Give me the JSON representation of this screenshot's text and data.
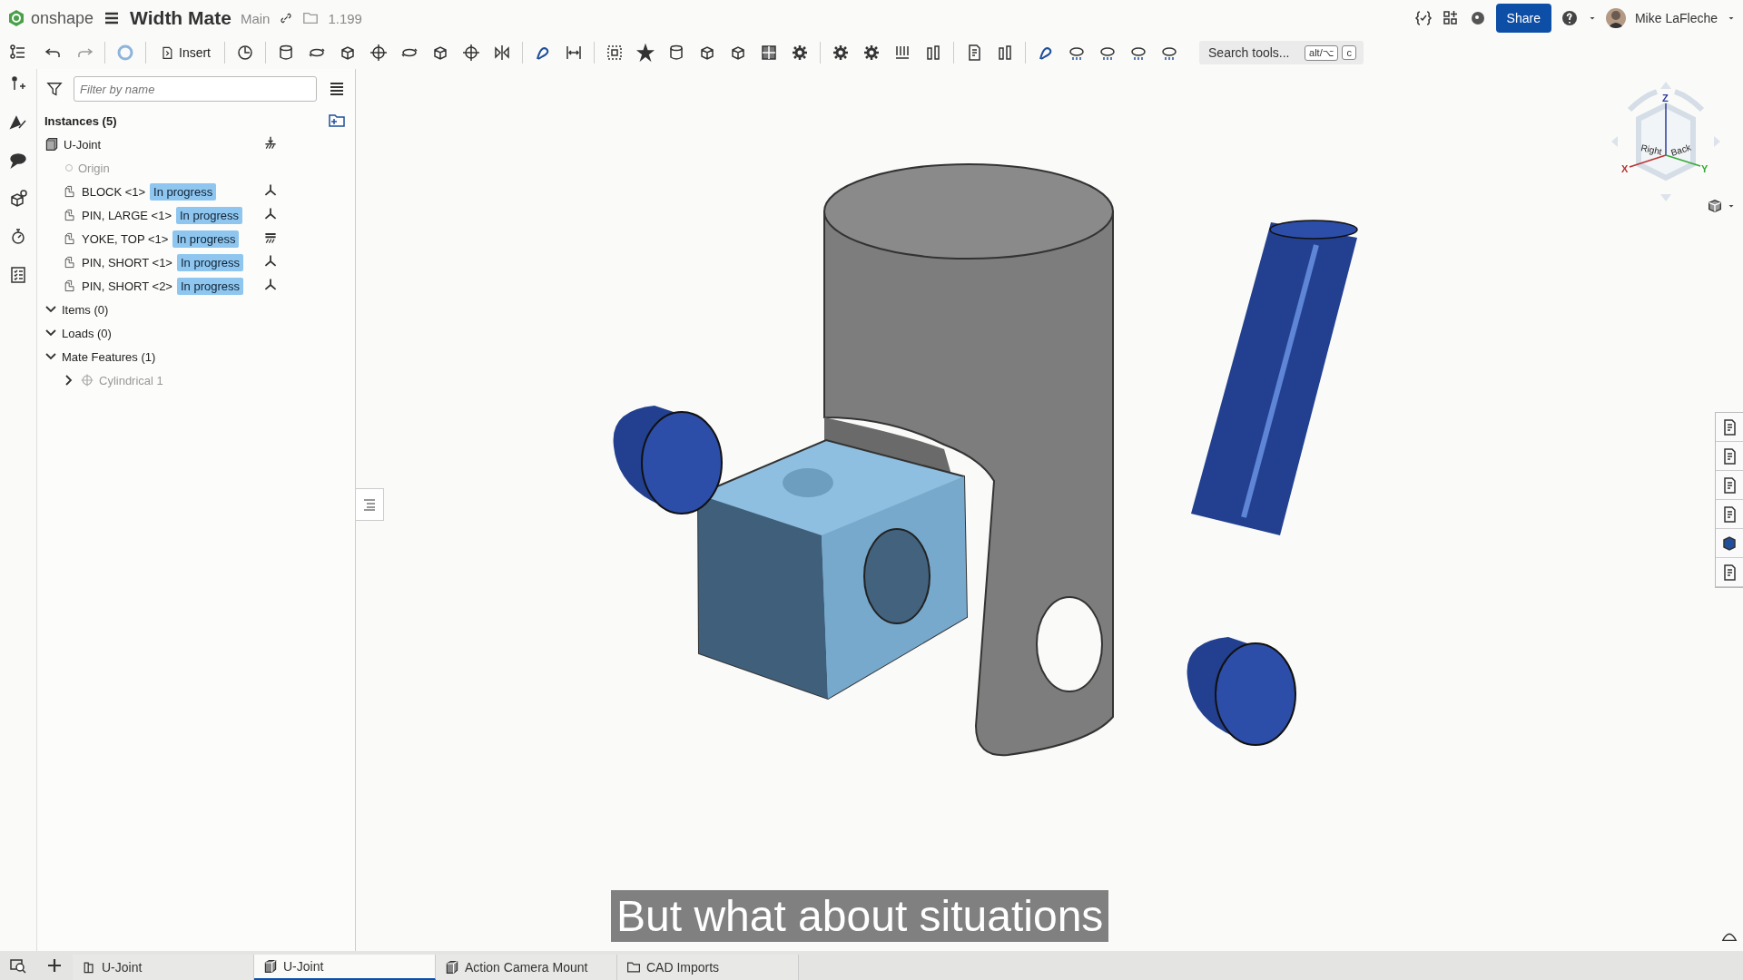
{
  "header": {
    "logo": "onshape",
    "document_title": "Width Mate",
    "branch": "Main",
    "version": "1.199",
    "share_button": "Share",
    "user_name": "Mike LaFleche"
  },
  "toolbar": {
    "insert_label": "Insert",
    "search": {
      "placeholder": "Search tools...",
      "keys": [
        "alt/⌥",
        "c"
      ]
    }
  },
  "feature_tree": {
    "filter_placeholder": "Filter by name",
    "instances_header": "Instances (5)",
    "root": {
      "name": "U-Joint",
      "kind": "grounded"
    },
    "origin": "Origin",
    "instances": [
      {
        "name": "BLOCK <1>",
        "status": "In progress",
        "kind": "free"
      },
      {
        "name": "PIN, LARGE <1>",
        "status": "In progress",
        "kind": "free"
      },
      {
        "name": "YOKE, TOP <1>",
        "status": "In progress",
        "kind": "fixed"
      },
      {
        "name": "PIN, SHORT <1>",
        "status": "In progress",
        "kind": "free"
      },
      {
        "name": "PIN, SHORT <2>",
        "status": "In progress",
        "kind": "free"
      }
    ],
    "sections": [
      {
        "label": "Items (0)",
        "expanded": true
      },
      {
        "label": "Loads (0)",
        "expanded": true
      },
      {
        "label": "Mate Features (1)",
        "expanded": true,
        "children": [
          {
            "label": "Cylindrical 1",
            "expanded": false
          }
        ]
      }
    ]
  },
  "view_cube": {
    "faces": [
      "Right",
      "Back"
    ],
    "axes": [
      "Z",
      "X",
      "Y"
    ]
  },
  "caption": "But what about situations",
  "tabs": [
    {
      "label": "U-Joint",
      "kind": "part-studio",
      "selected": false
    },
    {
      "label": "U-Joint",
      "kind": "assembly",
      "selected": true
    },
    {
      "label": "Action Camera Mount",
      "kind": "assembly",
      "selected": false
    },
    {
      "label": "CAD Imports",
      "kind": "folder",
      "selected": false
    }
  ]
}
